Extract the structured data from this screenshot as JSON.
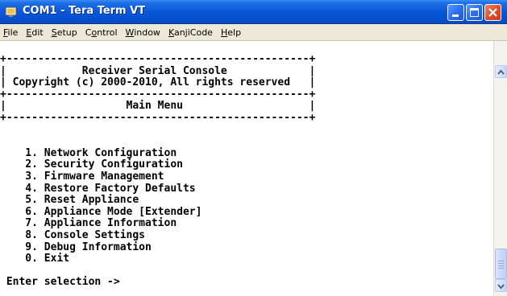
{
  "window": {
    "title": "COM1 - Tera Term VT"
  },
  "menu": [
    "File",
    "Edit",
    "Setup",
    "Control",
    "Window",
    "KanjiCode",
    "Help"
  ],
  "terminal": {
    "lines": [
      "+------------------------------------------------+",
      "|            Receiver Serial Console             |",
      "| Copyright (c) 2000-2010, All rights reserved   |",
      "+------------------------------------------------+",
      "|                   Main Menu                    |",
      "+------------------------------------------------+",
      "",
      "",
      "    1. Network Configuration",
      "    2. Security Configuration",
      "    3. Firmware Management",
      "    4. Restore Factory Defaults",
      "    5. Reset Appliance",
      "    6. Appliance Mode [Extender]",
      "    7. Appliance Information",
      "    8. Console Settings",
      "    9. Debug Information",
      "    0. Exit",
      "",
      " Enter selection ->"
    ]
  },
  "icons": {
    "app": "tera-term-icon",
    "minimize": "minimize-icon",
    "maximize": "maximize-icon",
    "close": "close-icon",
    "scroll_up": "scroll-up-arrow-icon",
    "scroll_down": "scroll-down-arrow-icon"
  },
  "colors": {
    "titlebar": "#0a58d8",
    "close_button": "#e0502c",
    "menubar": "#ece9d8",
    "terminal_bg": "#ffffff",
    "terminal_fg": "#000000"
  }
}
